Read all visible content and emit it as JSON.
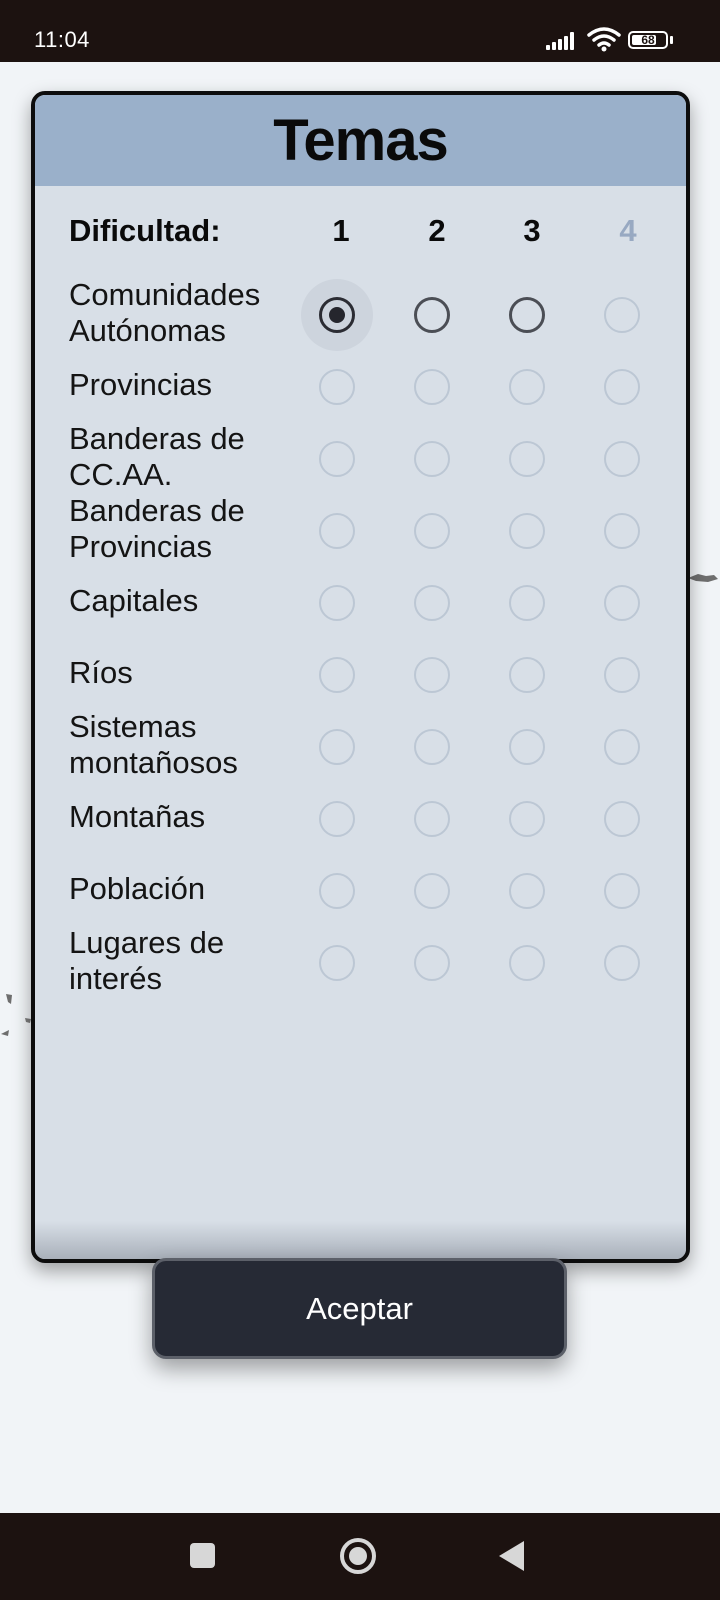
{
  "status_bar": {
    "time": "11:04",
    "battery": "68",
    "icons": [
      "signal-icon",
      "wifi-icon",
      "battery-icon"
    ]
  },
  "dialog": {
    "title": "Temas",
    "difficulty_label": "Dificultad:",
    "levels": [
      {
        "label": "1",
        "enabled": true
      },
      {
        "label": "2",
        "enabled": true
      },
      {
        "label": "3",
        "enabled": true
      },
      {
        "label": "4",
        "enabled": false
      }
    ],
    "topics": [
      {
        "label": "Comunidades Autónomas",
        "selected_level": "1",
        "enabled": true
      },
      {
        "label": "Provincias",
        "selected_level": null,
        "enabled": false
      },
      {
        "label": "Banderas de CC.AA.",
        "selected_level": null,
        "enabled": false
      },
      {
        "label": "Banderas de Provincias",
        "selected_level": null,
        "enabled": false
      },
      {
        "label": "Capitales",
        "selected_level": null,
        "enabled": false
      },
      {
        "label": "Ríos",
        "selected_level": null,
        "enabled": false
      },
      {
        "label": "Sistemas montañosos",
        "selected_level": null,
        "enabled": false
      },
      {
        "label": "Montañas",
        "selected_level": null,
        "enabled": false
      },
      {
        "label": "Población",
        "selected_level": null,
        "enabled": false
      },
      {
        "label": "Lugares de interés",
        "selected_level": null,
        "enabled": false
      }
    ]
  },
  "accept_button": {
    "label": "Aceptar"
  },
  "nav_bar": {
    "icons": [
      "recents-icon",
      "home-icon",
      "back-icon"
    ]
  },
  "colors": {
    "header": "#9ab0ca",
    "dialog_bg": "#d8dfe7",
    "button_bg": "#262a35",
    "disabled_level": "#98a9c2"
  }
}
